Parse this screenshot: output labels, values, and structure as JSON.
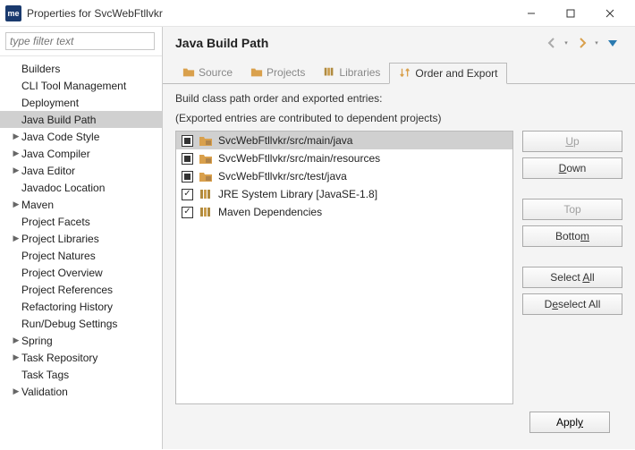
{
  "window": {
    "title": "Properties for SvcWebFtllvkr"
  },
  "sidebar": {
    "filter_placeholder": "type filter text",
    "items": [
      {
        "label": "Builders",
        "expandable": false
      },
      {
        "label": "CLI Tool Management",
        "expandable": false
      },
      {
        "label": "Deployment",
        "expandable": false
      },
      {
        "label": "Java Build Path",
        "expandable": false,
        "selected": true
      },
      {
        "label": "Java Code Style",
        "expandable": true
      },
      {
        "label": "Java Compiler",
        "expandable": true
      },
      {
        "label": "Java Editor",
        "expandable": true
      },
      {
        "label": "Javadoc Location",
        "expandable": false
      },
      {
        "label": "Maven",
        "expandable": true
      },
      {
        "label": "Project Facets",
        "expandable": false
      },
      {
        "label": "Project Libraries",
        "expandable": true
      },
      {
        "label": "Project Natures",
        "expandable": false
      },
      {
        "label": "Project Overview",
        "expandable": false
      },
      {
        "label": "Project References",
        "expandable": false
      },
      {
        "label": "Refactoring History",
        "expandable": false
      },
      {
        "label": "Run/Debug Settings",
        "expandable": false
      },
      {
        "label": "Spring",
        "expandable": true
      },
      {
        "label": "Task Repository",
        "expandable": true
      },
      {
        "label": "Task Tags",
        "expandable": false
      },
      {
        "label": "Validation",
        "expandable": true
      }
    ]
  },
  "page": {
    "title": "Java Build Path",
    "tabs": {
      "source": "Source",
      "projects": "Projects",
      "libraries": "Libraries",
      "order": "Order and Export"
    },
    "help1": "Build class path order and exported entries:",
    "help2": "(Exported entries are contributed to dependent projects)",
    "entries": [
      {
        "label": "SvcWebFtllvkr/src/main/java",
        "kind": "src",
        "check": "filled",
        "selected": true
      },
      {
        "label": "SvcWebFtllvkr/src/main/resources",
        "kind": "src",
        "check": "filled"
      },
      {
        "label": "SvcWebFtllvkr/src/test/java",
        "kind": "src",
        "check": "filled"
      },
      {
        "label": "JRE System Library [JavaSE-1.8]",
        "kind": "lib",
        "check": "checked"
      },
      {
        "label": "Maven Dependencies",
        "kind": "lib",
        "check": "checked"
      }
    ],
    "buttons": {
      "up": "Up",
      "down": "Down",
      "top": "Top",
      "bottom": "Bottom",
      "select_all": "Select All",
      "deselect_all": "Deselect All",
      "apply": "Apply"
    }
  }
}
